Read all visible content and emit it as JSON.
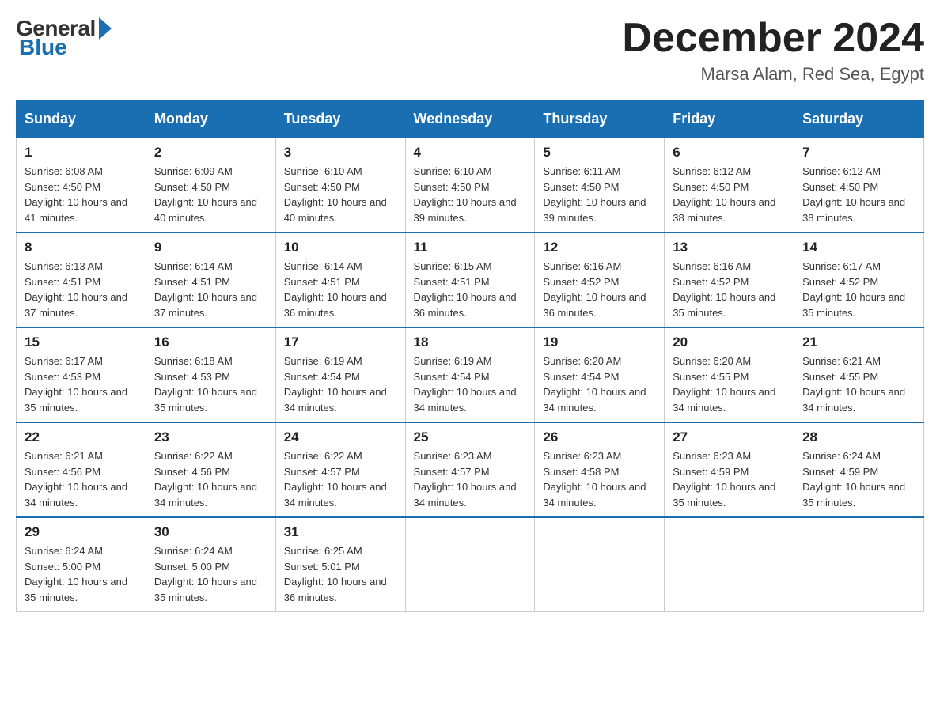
{
  "logo": {
    "general": "General",
    "blue": "Blue"
  },
  "title": {
    "month": "December 2024",
    "location": "Marsa Alam, Red Sea, Egypt"
  },
  "days_of_week": [
    "Sunday",
    "Monday",
    "Tuesday",
    "Wednesday",
    "Thursday",
    "Friday",
    "Saturday"
  ],
  "weeks": [
    [
      {
        "day": "1",
        "sunrise": "6:08 AM",
        "sunset": "4:50 PM",
        "daylight": "10 hours and 41 minutes."
      },
      {
        "day": "2",
        "sunrise": "6:09 AM",
        "sunset": "4:50 PM",
        "daylight": "10 hours and 40 minutes."
      },
      {
        "day": "3",
        "sunrise": "6:10 AM",
        "sunset": "4:50 PM",
        "daylight": "10 hours and 40 minutes."
      },
      {
        "day": "4",
        "sunrise": "6:10 AM",
        "sunset": "4:50 PM",
        "daylight": "10 hours and 39 minutes."
      },
      {
        "day": "5",
        "sunrise": "6:11 AM",
        "sunset": "4:50 PM",
        "daylight": "10 hours and 39 minutes."
      },
      {
        "day": "6",
        "sunrise": "6:12 AM",
        "sunset": "4:50 PM",
        "daylight": "10 hours and 38 minutes."
      },
      {
        "day": "7",
        "sunrise": "6:12 AM",
        "sunset": "4:50 PM",
        "daylight": "10 hours and 38 minutes."
      }
    ],
    [
      {
        "day": "8",
        "sunrise": "6:13 AM",
        "sunset": "4:51 PM",
        "daylight": "10 hours and 37 minutes."
      },
      {
        "day": "9",
        "sunrise": "6:14 AM",
        "sunset": "4:51 PM",
        "daylight": "10 hours and 37 minutes."
      },
      {
        "day": "10",
        "sunrise": "6:14 AM",
        "sunset": "4:51 PM",
        "daylight": "10 hours and 36 minutes."
      },
      {
        "day": "11",
        "sunrise": "6:15 AM",
        "sunset": "4:51 PM",
        "daylight": "10 hours and 36 minutes."
      },
      {
        "day": "12",
        "sunrise": "6:16 AM",
        "sunset": "4:52 PM",
        "daylight": "10 hours and 36 minutes."
      },
      {
        "day": "13",
        "sunrise": "6:16 AM",
        "sunset": "4:52 PM",
        "daylight": "10 hours and 35 minutes."
      },
      {
        "day": "14",
        "sunrise": "6:17 AM",
        "sunset": "4:52 PM",
        "daylight": "10 hours and 35 minutes."
      }
    ],
    [
      {
        "day": "15",
        "sunrise": "6:17 AM",
        "sunset": "4:53 PM",
        "daylight": "10 hours and 35 minutes."
      },
      {
        "day": "16",
        "sunrise": "6:18 AM",
        "sunset": "4:53 PM",
        "daylight": "10 hours and 35 minutes."
      },
      {
        "day": "17",
        "sunrise": "6:19 AM",
        "sunset": "4:54 PM",
        "daylight": "10 hours and 34 minutes."
      },
      {
        "day": "18",
        "sunrise": "6:19 AM",
        "sunset": "4:54 PM",
        "daylight": "10 hours and 34 minutes."
      },
      {
        "day": "19",
        "sunrise": "6:20 AM",
        "sunset": "4:54 PM",
        "daylight": "10 hours and 34 minutes."
      },
      {
        "day": "20",
        "sunrise": "6:20 AM",
        "sunset": "4:55 PM",
        "daylight": "10 hours and 34 minutes."
      },
      {
        "day": "21",
        "sunrise": "6:21 AM",
        "sunset": "4:55 PM",
        "daylight": "10 hours and 34 minutes."
      }
    ],
    [
      {
        "day": "22",
        "sunrise": "6:21 AM",
        "sunset": "4:56 PM",
        "daylight": "10 hours and 34 minutes."
      },
      {
        "day": "23",
        "sunrise": "6:22 AM",
        "sunset": "4:56 PM",
        "daylight": "10 hours and 34 minutes."
      },
      {
        "day": "24",
        "sunrise": "6:22 AM",
        "sunset": "4:57 PM",
        "daylight": "10 hours and 34 minutes."
      },
      {
        "day": "25",
        "sunrise": "6:23 AM",
        "sunset": "4:57 PM",
        "daylight": "10 hours and 34 minutes."
      },
      {
        "day": "26",
        "sunrise": "6:23 AM",
        "sunset": "4:58 PM",
        "daylight": "10 hours and 34 minutes."
      },
      {
        "day": "27",
        "sunrise": "6:23 AM",
        "sunset": "4:59 PM",
        "daylight": "10 hours and 35 minutes."
      },
      {
        "day": "28",
        "sunrise": "6:24 AM",
        "sunset": "4:59 PM",
        "daylight": "10 hours and 35 minutes."
      }
    ],
    [
      {
        "day": "29",
        "sunrise": "6:24 AM",
        "sunset": "5:00 PM",
        "daylight": "10 hours and 35 minutes."
      },
      {
        "day": "30",
        "sunrise": "6:24 AM",
        "sunset": "5:00 PM",
        "daylight": "10 hours and 35 minutes."
      },
      {
        "day": "31",
        "sunrise": "6:25 AM",
        "sunset": "5:01 PM",
        "daylight": "10 hours and 36 minutes."
      },
      null,
      null,
      null,
      null
    ]
  ]
}
